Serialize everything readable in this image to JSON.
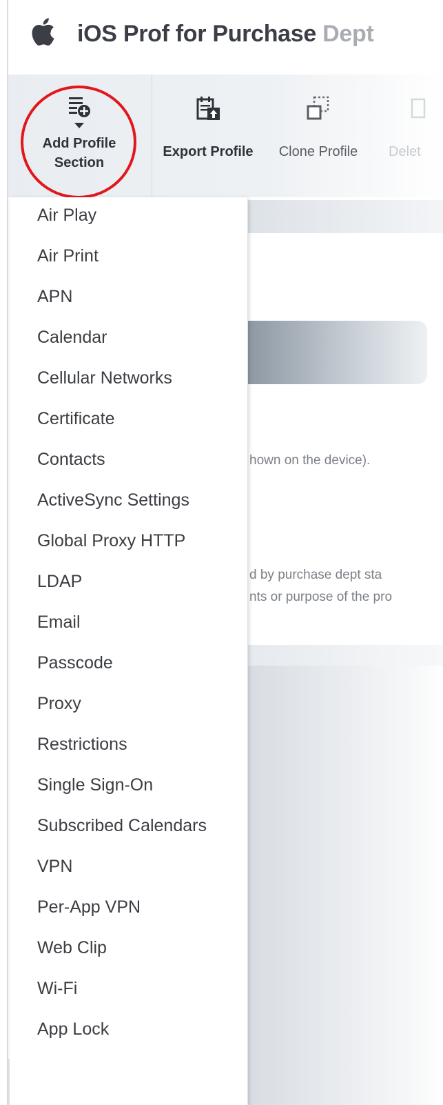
{
  "header": {
    "logo_icon": "apple-icon",
    "title_main": "iOS Prof for Purchase ",
    "title_faded": "Dept"
  },
  "toolbar": {
    "add_profile_section": {
      "label_line1": "Add Profile",
      "label_line2": "Section",
      "icon": "add-list-icon"
    },
    "export_profile": {
      "label": "Export Profile",
      "icon": "export-icon"
    },
    "clone_profile": {
      "label": "Clone Profile",
      "icon": "clone-icon"
    },
    "delete_profile": {
      "label": "Delet",
      "icon": "delete-icon"
    }
  },
  "background": {
    "text1": "hown on the device).",
    "text2": "d by purchase dept sta",
    "text3": "nts or purpose of the pro"
  },
  "menu": {
    "items": [
      "Air Play",
      "Air Print",
      "APN",
      "Calendar",
      "Cellular Networks",
      "Certificate",
      "Contacts",
      "ActiveSync Settings",
      "Global Proxy HTTP",
      "LDAP",
      "Email",
      "Passcode",
      "Proxy",
      "Restrictions",
      "Single Sign-On",
      "Subscribed Calendars",
      "VPN",
      "Per-App VPN",
      "Web Clip",
      "Wi-Fi",
      "App Lock"
    ]
  },
  "colors": {
    "annotation_circle": "#e2161b",
    "toolbar_bg": "#e9edf1",
    "icon_dark": "#2f3339"
  }
}
